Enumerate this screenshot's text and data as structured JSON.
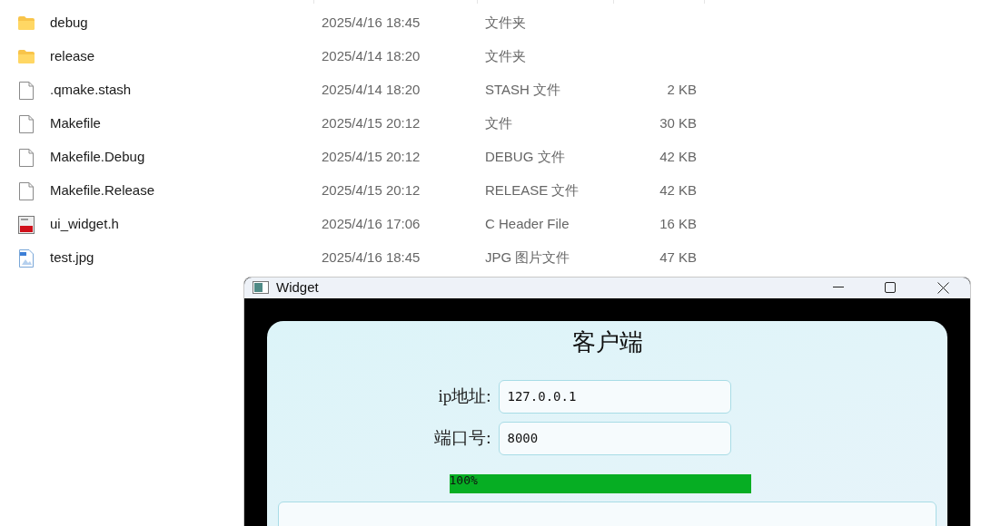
{
  "files": [
    {
      "name": "debug",
      "date": "2025/4/16 18:45",
      "type": "文件夹",
      "kind": "folder"
    },
    {
      "name": "release",
      "date": "2025/4/14 18:20",
      "type": "文件夹",
      "kind": "folder"
    },
    {
      "name": ".qmake.stash",
      "date": "2025/4/14 18:20",
      "type": "STASH 文件",
      "size": "2 KB",
      "kind": "file"
    },
    {
      "name": "Makefile",
      "date": "2025/4/15 20:12",
      "type": "文件",
      "size": "30 KB",
      "kind": "file"
    },
    {
      "name": "Makefile.Debug",
      "date": "2025/4/15 20:12",
      "type": "DEBUG 文件",
      "size": "42 KB",
      "kind": "file"
    },
    {
      "name": "Makefile.Release",
      "date": "2025/4/15 20:12",
      "type": "RELEASE 文件",
      "size": "42 KB",
      "kind": "file"
    },
    {
      "name": "ui_widget.h",
      "date": "2025/4/16 17:06",
      "type": "C Header File",
      "size": "16 KB",
      "kind": "header"
    },
    {
      "name": "test.jpg",
      "date": "2025/4/16 18:45",
      "type": "JPG 图片文件",
      "size": "47 KB",
      "kind": "image"
    }
  ],
  "window": {
    "title": "Widget"
  },
  "client": {
    "heading": "客户端",
    "fields": [
      {
        "label": "ip地址:",
        "value": "127.0.0.1"
      },
      {
        "label": "端口号:",
        "value": "8000"
      }
    ],
    "progress": {
      "level": 1,
      "reading": "100%"
    }
  }
}
